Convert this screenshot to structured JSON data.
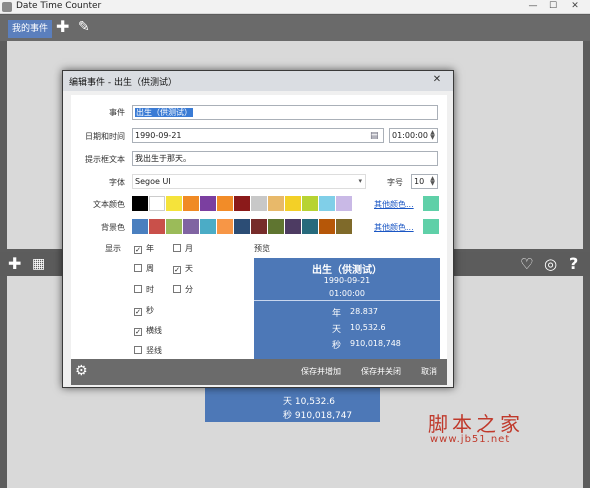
{
  "window": {
    "title": "Date Time Counter",
    "min_glyph": "—",
    "max_glyph": "☐",
    "close_glyph": "✕"
  },
  "toolbar": {
    "tab_label": "我的事件",
    "add_icon": "plus-icon",
    "edit_icon": "edit-note-icon"
  },
  "bar2_icons": [
    "plus-icon",
    "grid-icon",
    "heart-add-icon",
    "globe-icon",
    "help-icon"
  ],
  "dialog": {
    "title": "编辑事件 - 出生（供测试）",
    "close_glyph": "✕",
    "fields": {
      "event_label": "事件",
      "event_value": "出生（供测试）",
      "datetime_label": "日期和时间",
      "date_value": "1990-09-21",
      "time_value": "01:00:00",
      "tooltip_label": "提示框文本",
      "tooltip_value": "我出生于那天。",
      "font_label": "字体",
      "font_value": "Segoe UI",
      "size_label": "字号",
      "size_value": "10",
      "text_color_label": "文本颜色",
      "bg_color_label": "背景色",
      "more_colors_1": "其他颜色...",
      "more_colors_2": "其他颜色...",
      "display_label": "显示",
      "preview_label": "预览"
    },
    "text_colors": [
      "#000000",
      "#ffffff",
      "#f5e33b",
      "#f08a24",
      "#7b3fa0",
      "#f28c28",
      "#8b1a1a",
      "#c8c8c8",
      "#e8b96a",
      "#f3d027",
      "#b7d333",
      "#80cfe8",
      "#c9b9e6"
    ],
    "text_color_current": "#5fd0a8",
    "bg_colors": [
      "#4a7fbf",
      "#c9504a",
      "#9bbb59",
      "#8064a2",
      "#4bacc6",
      "#f79646",
      "#2c4d75",
      "#772c2a",
      "#5f7530",
      "#4d3b62",
      "#276a7c",
      "#b65708",
      "#7f6a2a"
    ],
    "bg_color_current": "#5fd0a8",
    "display_options": [
      {
        "label": "年",
        "checked": true
      },
      {
        "label": "月",
        "checked": false
      },
      {
        "label": "周",
        "checked": false
      },
      {
        "label": "天",
        "checked": true
      },
      {
        "label": "时",
        "checked": false
      },
      {
        "label": "分",
        "checked": false
      },
      {
        "label": "秒",
        "checked": true
      },
      {
        "label": "横线",
        "checked": true
      },
      {
        "label": "竖线",
        "checked": false
      }
    ],
    "preview": {
      "name": "出生（供测试）",
      "date": "1990-09-21",
      "time": "01:00:00",
      "rows": [
        {
          "unit": "年",
          "value": "28.837"
        },
        {
          "unit": "天",
          "value": "10,532.6"
        },
        {
          "unit": "秒",
          "value": "910,018,748"
        }
      ]
    },
    "footer": {
      "save_add": "保存并增加",
      "save_close": "保存并关闭",
      "cancel": "取消"
    }
  },
  "background_card": {
    "rows": [
      {
        "unit": "天",
        "value": "10,532.6"
      },
      {
        "unit": "秒",
        "value": "910,018,747"
      }
    ]
  },
  "watermark": {
    "text": "脚本之家",
    "url": "www.jb51.net"
  }
}
